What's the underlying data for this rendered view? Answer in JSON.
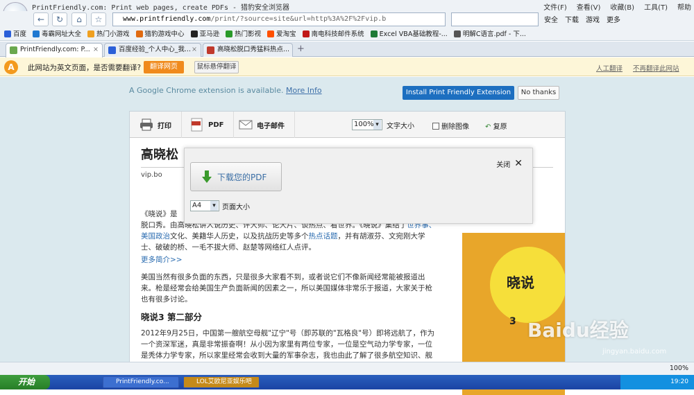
{
  "window": {
    "title": "PrintFriendly.com: Print web pages, create PDFs - 猎豹安全浏览器",
    "menu": [
      "文件(F)",
      "查看(V)",
      "收藏(B)",
      "工具(T)",
      "帮助"
    ]
  },
  "address": {
    "domain": "www.printfriendly.com",
    "path": "/print/?source=site&url=http%3A%2F%2Fvip.b"
  },
  "toolbar_right": {
    "safe": "安全",
    "download": "下载",
    "games": "游戏",
    "more": "更多"
  },
  "bookmarks": [
    {
      "label": "百度",
      "color": "#2b5fd8"
    },
    {
      "label": "毒霸网址大全",
      "color": "#1f78d1"
    },
    {
      "label": "热门小游戏",
      "color": "#f0a020"
    },
    {
      "label": "猎豹游戏中心",
      "color": "#e06a10"
    },
    {
      "label": "亚马逊",
      "color": "#222222"
    },
    {
      "label": "热门影视",
      "color": "#2a9a2a"
    },
    {
      "label": "爱淘宝",
      "color": "#ff5000"
    },
    {
      "label": "南电科技邮件系统",
      "color": "#c01818"
    },
    {
      "label": "Excel VBA基础教程-...",
      "color": "#1e7a36"
    },
    {
      "label": "明解C语言.pdf - 下...",
      "color": "#555555"
    }
  ],
  "tabs": [
    {
      "label": "PrintFriendly.com: P...",
      "color": "#6aa84f",
      "active": true
    },
    {
      "label": "百度经验_个人中心_我...",
      "color": "#2b5fd8",
      "active": false
    },
    {
      "label": "高晓松脱口秀猛料热点...",
      "color": "#c0392b",
      "active": false
    }
  ],
  "translate_bar": {
    "message": "此网站为英文页面，是否需要翻译?",
    "translate_button": "翻译网页",
    "hover_button": "鼠标悬停翻译",
    "manual_link": "人工翻译",
    "never_link": "不再翻译此网站"
  },
  "chrome_banner": {
    "message": "A Google Chrome extension is available.",
    "more_info": "More Info",
    "install": "Install Print Friendly Extension",
    "no_thanks": "No thanks"
  },
  "pf_toolbar": {
    "print": "打印",
    "pdf": "PDF",
    "email": "电子邮件",
    "text_size_value": "100%",
    "text_size_label": "文字大小",
    "delete_images": "删除图像",
    "undo": "复原"
  },
  "article": {
    "title": "高晓松",
    "source": "vip.bo",
    "para1_line1": "《晓说》是",
    "para1_line2": "脱口秀。由高晓松讲人说历史、评大师、论大片、谈热点、看世界。《晓说》集结了",
    "para1_line2_link": "世界事、美国政治",
    "para1_line3": "文化、美籍华人历史，以及抗战历史等多个",
    "para1_line3_link": "热点话题",
    "para1_line3_tail": "，并有胡淑芬、文宛刚大学士、破破的桥、一毛不拔大师、赵楚等网络红人点评。",
    "more": "更多简介>>",
    "para2": "美国当然有很多负面的东西，只是很多大家看不到，或者说它们不像新闻经常能被报道出来。枪是经常会给美国生产负面新闻的因素之一，所以美国媒体非常乐于报道，大家关于枪也有很多讨论。",
    "heading2": "晓说3 第二部分",
    "para3": "2012年9月25日，中国第一艘航空母舰\"辽宁\"号（即苏联的\"瓦格良\"号）即将远航了，作为一个资深军迷，真是非常振奋啊！从小因为家里有两位专家，一位是空气动力学专家，一位是秃体力学专家，所以家里经常会收到大量的军事杂志，我也由此了解了很多航空知识、舰船知识。",
    "book_title": "晓说",
    "book_number": "3"
  },
  "pdf_overlay": {
    "download": "下载您的PDF",
    "paper_value": "A4",
    "paper_label": "页面大小",
    "close": "关闭"
  },
  "status": {
    "zoom": "100%"
  },
  "taskbar": {
    "start": "开始",
    "tasks": [
      "PrintFriendly.co...",
      "LOL艾欧尼亚娱乐吧"
    ],
    "clock": "19:20"
  },
  "watermark": {
    "brand": "Baidu经验",
    "url": "jingyan.baidu.com"
  }
}
